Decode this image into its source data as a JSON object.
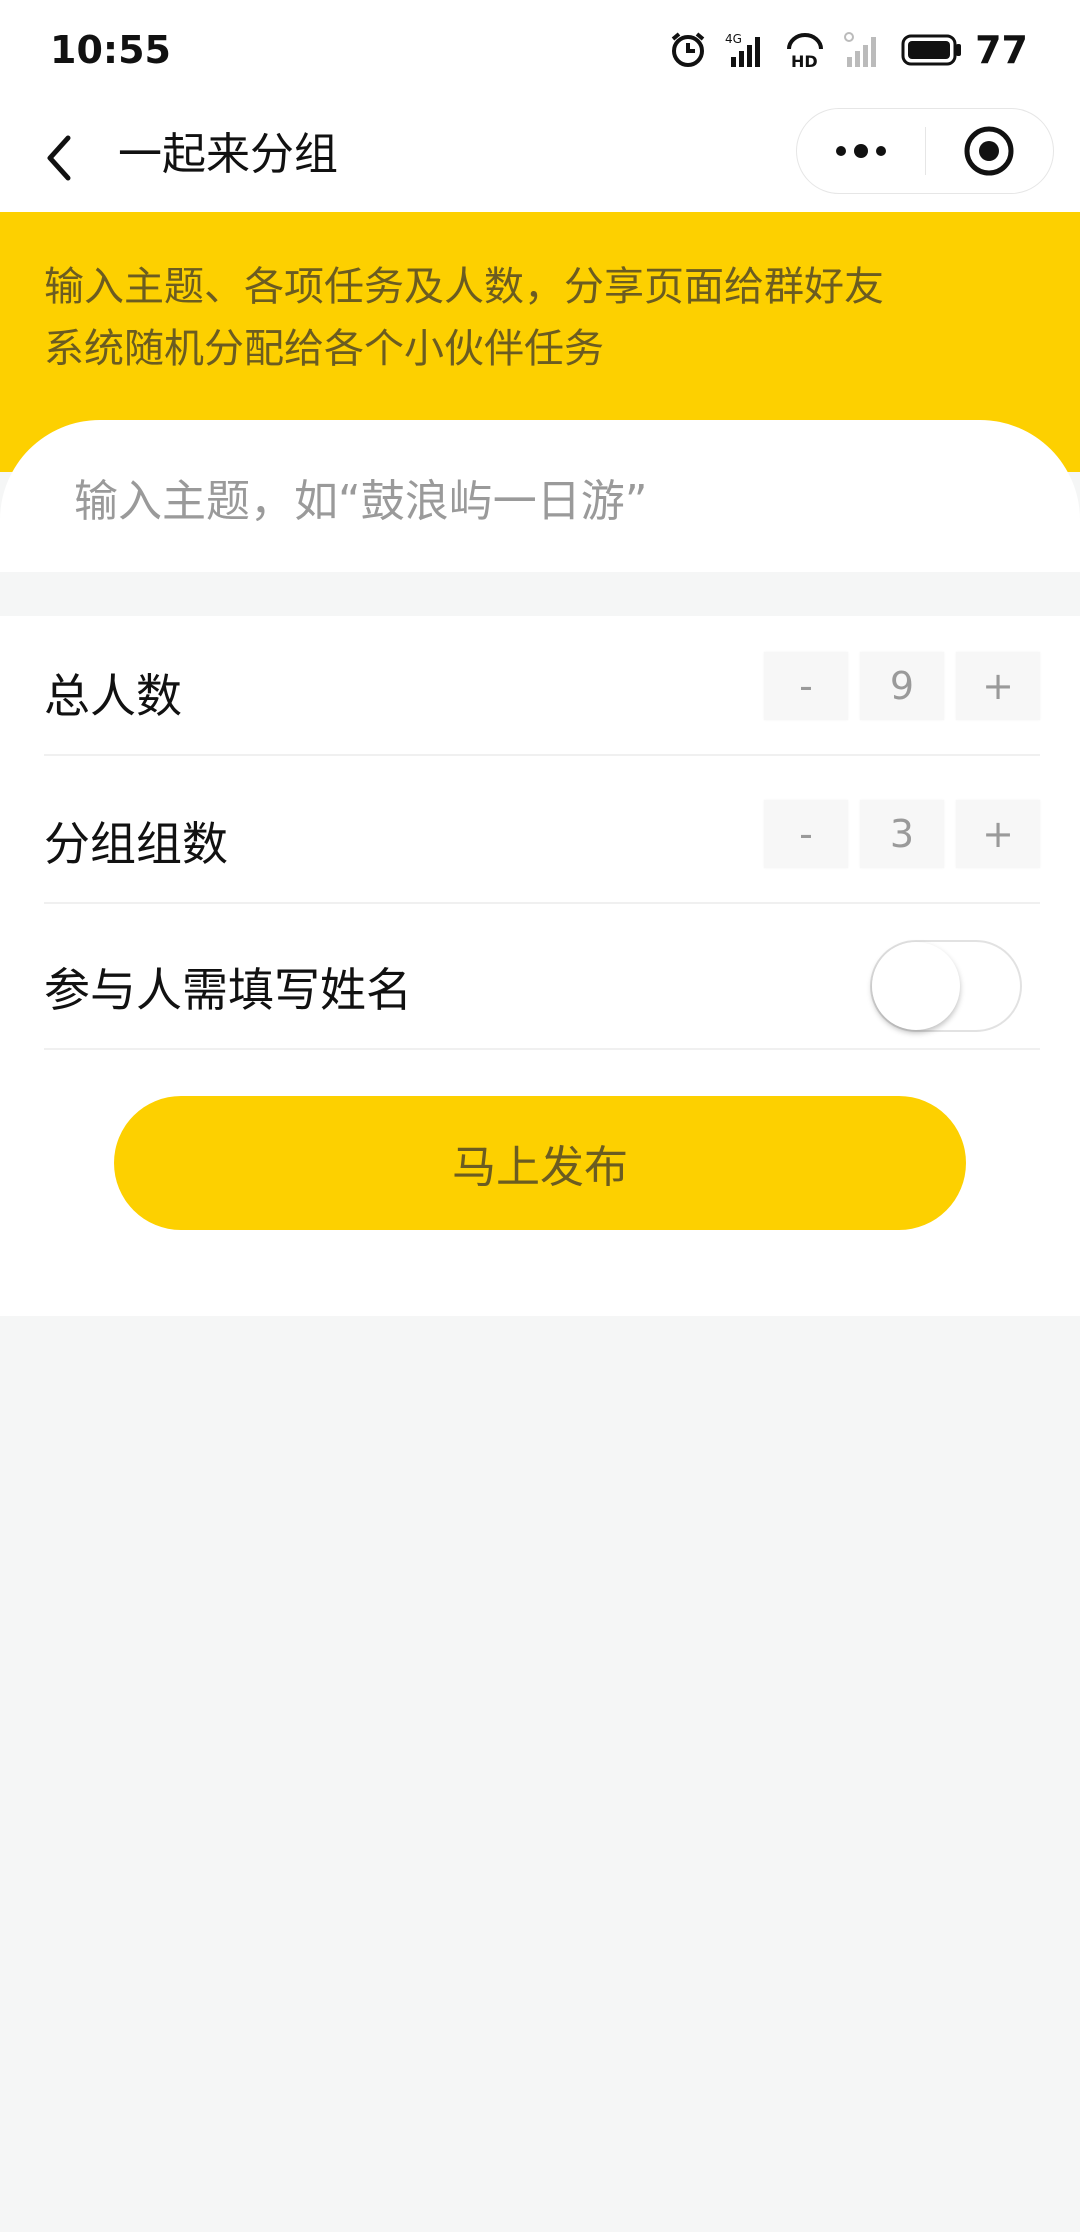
{
  "status_bar": {
    "time": "10:55",
    "battery": "77",
    "icons": [
      "alarm-icon",
      "signal-4g-icon",
      "hd-icon",
      "signal-weak-icon",
      "battery-icon"
    ]
  },
  "nav": {
    "title": "一起来分组",
    "back_icon": "chevron-left-icon",
    "menu_icon": "more-dots-icon",
    "close_icon": "target-circle-icon"
  },
  "banner": {
    "line1": "输入主题、各项任务及人数，分享页面给群好友",
    "line2": "系统随机分配给各个小伙伴任务"
  },
  "form": {
    "topic_placeholder": "输入主题，如“鼓浪屿一日游”",
    "total_people": {
      "label": "总人数",
      "minus": "-",
      "value": "9",
      "plus": "+"
    },
    "group_count": {
      "label": "分组组数",
      "minus": "-",
      "value": "3",
      "plus": "+"
    },
    "require_name": {
      "label": "参与人需填写姓名",
      "enabled": false
    },
    "publish_label": "马上发布"
  },
  "colors": {
    "accent": "#fdd000",
    "accent_text": "#6b5c21",
    "background": "#f5f6f6"
  }
}
